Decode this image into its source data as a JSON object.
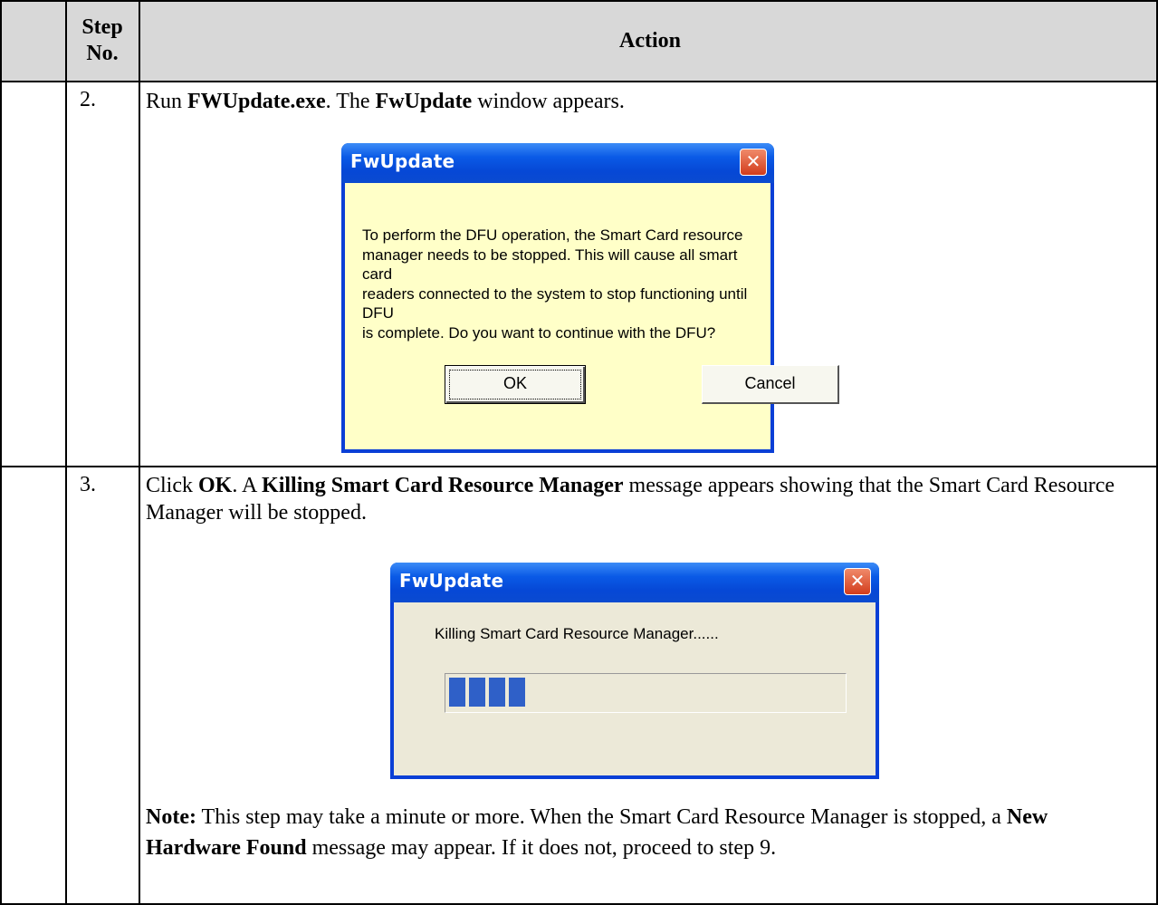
{
  "table": {
    "header": {
      "step_label": "Step No.",
      "action_label": "Action"
    },
    "rows": [
      {
        "step": "2.",
        "text_parts": [
          "Run ",
          "FWUpdate.exe",
          ".  The ",
          "FwUpdate",
          " window appears."
        ]
      },
      {
        "step": "3.",
        "text_parts": [
          "Click ",
          "OK",
          ".  A ",
          "Killing Smart Card Resource Manager",
          " message appears showing that the Smart Card Resource Manager will be stopped."
        ],
        "note_parts": [
          "Note:",
          "   This step may take a minute or more.  When the Smart Card Resource Manager is stopped, a ",
          "New Hardware Found",
          " message may appear.  If it does not, proceed to step 9."
        ]
      }
    ]
  },
  "dialog1": {
    "title": "FwUpdate",
    "close_glyph": "✕",
    "message_lines": [
      "To perform the DFU operation, the Smart Card resource",
      "manager needs to be stopped. This will cause all smart card",
      "readers connected to the system to stop functioning until DFU",
      "is complete. Do you want to continue with the DFU?"
    ],
    "ok_label": "OK",
    "cancel_label": "Cancel",
    "client_color": "#ffffc8"
  },
  "dialog2": {
    "title": "FwUpdate",
    "close_glyph": "✕",
    "message": "Killing Smart Card Resource Manager......",
    "progress_fraction": 0.18,
    "client_color": "#ece9d8"
  }
}
